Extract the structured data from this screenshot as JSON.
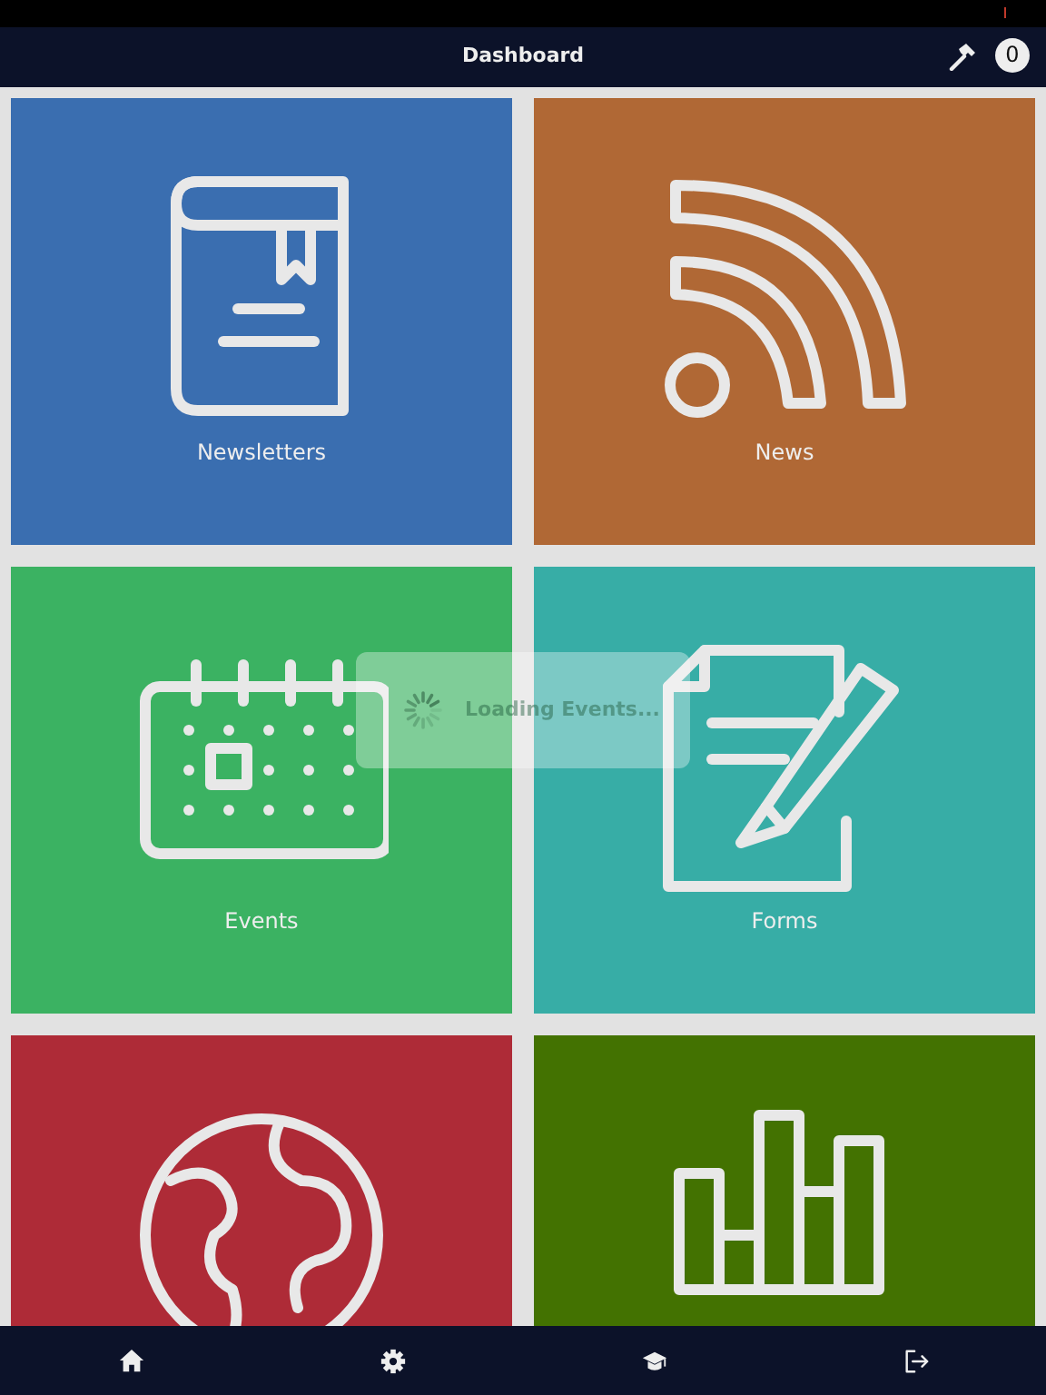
{
  "header": {
    "title": "Dashboard",
    "badge": "0"
  },
  "tiles": [
    {
      "label": "Newsletters",
      "color": "#3a6eb0",
      "kind": "book"
    },
    {
      "label": "News",
      "color": "#b06835",
      "kind": "rss"
    },
    {
      "label": "Events",
      "color": "#3bb262",
      "kind": "calendar"
    },
    {
      "label": "Forms",
      "color": "#37ada6",
      "kind": "form"
    },
    {
      "color": "#ae2b37",
      "kind": "globe"
    },
    {
      "color": "#437201",
      "kind": "chart"
    }
  ],
  "loading": {
    "text": "Loading Events..."
  },
  "bottom_nav": [
    {
      "kind": "home"
    },
    {
      "kind": "settings"
    },
    {
      "kind": "school"
    },
    {
      "kind": "logout"
    }
  ]
}
